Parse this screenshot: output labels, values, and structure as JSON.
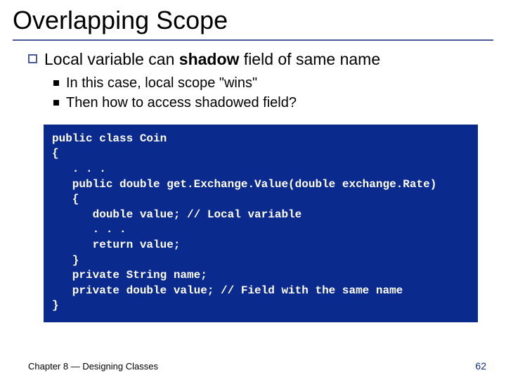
{
  "title": "Overlapping Scope",
  "point": {
    "pre": "Local variable can ",
    "bold": "shadow",
    "post": " field of same name"
  },
  "sub1": "In this case, local scope \"wins\"",
  "sub2": "Then how to access shadowed field?",
  "code": "public class Coin\n{\n   . . .\n   public double get.Exchange.Value(double exchange.Rate)\n   {\n      double value; // Local variable\n      . . .\n      return value;\n   }\n   private String name;\n   private double value; // Field with the same name\n}",
  "footer_left": "Chapter 8 — Designing Classes",
  "page_number": "62"
}
